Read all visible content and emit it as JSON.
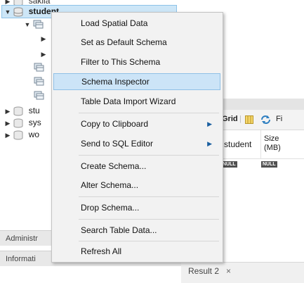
{
  "navigator": {
    "tree": [
      {
        "label": "sakila",
        "expanded": false,
        "kind": "schema"
      },
      {
        "label": "student",
        "expanded": true,
        "kind": "schema",
        "selected": true
      },
      {
        "label": "",
        "kind": "folder-tables",
        "expanded": true
      },
      {
        "label": "",
        "kind": "table"
      },
      {
        "label": "",
        "kind": "table"
      },
      {
        "label": "",
        "kind": "folder-views"
      },
      {
        "label": "",
        "kind": "folder-procs"
      },
      {
        "label": "",
        "kind": "folder-funcs"
      },
      {
        "label": "stu",
        "expanded": false,
        "kind": "schema"
      },
      {
        "label": "sys",
        "expanded": false,
        "kind": "schema"
      },
      {
        "label": "wo",
        "expanded": false,
        "kind": "schema"
      }
    ],
    "administration_tab": "Administr",
    "information_tab": "Informati"
  },
  "context_menu": {
    "items": [
      {
        "label": "Load Spatial Data"
      },
      {
        "label": "Set as Default Schema"
      },
      {
        "label": "Filter to This Schema"
      },
      {
        "label": "Schema Inspector",
        "hover": true
      },
      {
        "label": "Table Data Import Wizard"
      },
      {
        "label": "Copy to Clipboard",
        "submenu": true
      },
      {
        "label": "Send to SQL Editor",
        "submenu": true
      },
      {
        "label": "Create Schema..."
      },
      {
        "label": "Alter Schema..."
      },
      {
        "label": "Drop Schema..."
      },
      {
        "label": "Search Table Data..."
      },
      {
        "label": "Refresh All"
      }
    ],
    "hover_color": "#cce4f7"
  },
  "result_panel": {
    "toolbar": {
      "grid_label": "Grid",
      "filter_label": "Fi"
    },
    "columns": [
      {
        "label": "student"
      },
      {
        "label": "Size\n(MB)"
      }
    ],
    "null_label": "NULL",
    "tab_label": "Result 2",
    "tab_close": "×"
  },
  "icons": {
    "expand": "▶",
    "collapse": "▼",
    "submenu": "▶"
  },
  "colors": {
    "selection": "#cde6f7",
    "menu_background": "#f2f2f2"
  }
}
